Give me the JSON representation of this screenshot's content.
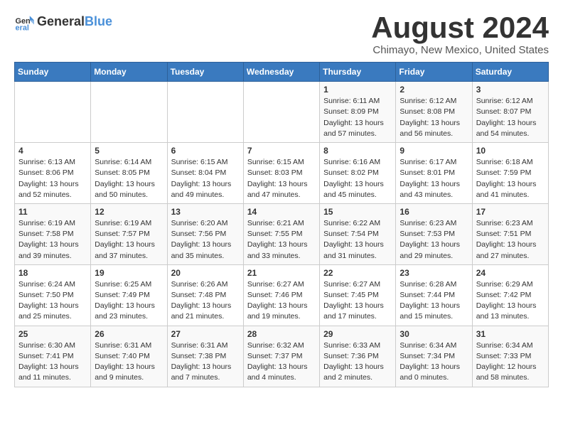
{
  "header": {
    "logo_general": "General",
    "logo_blue": "Blue",
    "month_year": "August 2024",
    "location": "Chimayo, New Mexico, United States"
  },
  "weekdays": [
    "Sunday",
    "Monday",
    "Tuesday",
    "Wednesday",
    "Thursday",
    "Friday",
    "Saturday"
  ],
  "weeks": [
    [
      {
        "day": "",
        "info": ""
      },
      {
        "day": "",
        "info": ""
      },
      {
        "day": "",
        "info": ""
      },
      {
        "day": "",
        "info": ""
      },
      {
        "day": "1",
        "info": "Sunrise: 6:11 AM\nSunset: 8:09 PM\nDaylight: 13 hours\nand 57 minutes."
      },
      {
        "day": "2",
        "info": "Sunrise: 6:12 AM\nSunset: 8:08 PM\nDaylight: 13 hours\nand 56 minutes."
      },
      {
        "day": "3",
        "info": "Sunrise: 6:12 AM\nSunset: 8:07 PM\nDaylight: 13 hours\nand 54 minutes."
      }
    ],
    [
      {
        "day": "4",
        "info": "Sunrise: 6:13 AM\nSunset: 8:06 PM\nDaylight: 13 hours\nand 52 minutes."
      },
      {
        "day": "5",
        "info": "Sunrise: 6:14 AM\nSunset: 8:05 PM\nDaylight: 13 hours\nand 50 minutes."
      },
      {
        "day": "6",
        "info": "Sunrise: 6:15 AM\nSunset: 8:04 PM\nDaylight: 13 hours\nand 49 minutes."
      },
      {
        "day": "7",
        "info": "Sunrise: 6:15 AM\nSunset: 8:03 PM\nDaylight: 13 hours\nand 47 minutes."
      },
      {
        "day": "8",
        "info": "Sunrise: 6:16 AM\nSunset: 8:02 PM\nDaylight: 13 hours\nand 45 minutes."
      },
      {
        "day": "9",
        "info": "Sunrise: 6:17 AM\nSunset: 8:01 PM\nDaylight: 13 hours\nand 43 minutes."
      },
      {
        "day": "10",
        "info": "Sunrise: 6:18 AM\nSunset: 7:59 PM\nDaylight: 13 hours\nand 41 minutes."
      }
    ],
    [
      {
        "day": "11",
        "info": "Sunrise: 6:19 AM\nSunset: 7:58 PM\nDaylight: 13 hours\nand 39 minutes."
      },
      {
        "day": "12",
        "info": "Sunrise: 6:19 AM\nSunset: 7:57 PM\nDaylight: 13 hours\nand 37 minutes."
      },
      {
        "day": "13",
        "info": "Sunrise: 6:20 AM\nSunset: 7:56 PM\nDaylight: 13 hours\nand 35 minutes."
      },
      {
        "day": "14",
        "info": "Sunrise: 6:21 AM\nSunset: 7:55 PM\nDaylight: 13 hours\nand 33 minutes."
      },
      {
        "day": "15",
        "info": "Sunrise: 6:22 AM\nSunset: 7:54 PM\nDaylight: 13 hours\nand 31 minutes."
      },
      {
        "day": "16",
        "info": "Sunrise: 6:23 AM\nSunset: 7:53 PM\nDaylight: 13 hours\nand 29 minutes."
      },
      {
        "day": "17",
        "info": "Sunrise: 6:23 AM\nSunset: 7:51 PM\nDaylight: 13 hours\nand 27 minutes."
      }
    ],
    [
      {
        "day": "18",
        "info": "Sunrise: 6:24 AM\nSunset: 7:50 PM\nDaylight: 13 hours\nand 25 minutes."
      },
      {
        "day": "19",
        "info": "Sunrise: 6:25 AM\nSunset: 7:49 PM\nDaylight: 13 hours\nand 23 minutes."
      },
      {
        "day": "20",
        "info": "Sunrise: 6:26 AM\nSunset: 7:48 PM\nDaylight: 13 hours\nand 21 minutes."
      },
      {
        "day": "21",
        "info": "Sunrise: 6:27 AM\nSunset: 7:46 PM\nDaylight: 13 hours\nand 19 minutes."
      },
      {
        "day": "22",
        "info": "Sunrise: 6:27 AM\nSunset: 7:45 PM\nDaylight: 13 hours\nand 17 minutes."
      },
      {
        "day": "23",
        "info": "Sunrise: 6:28 AM\nSunset: 7:44 PM\nDaylight: 13 hours\nand 15 minutes."
      },
      {
        "day": "24",
        "info": "Sunrise: 6:29 AM\nSunset: 7:42 PM\nDaylight: 13 hours\nand 13 minutes."
      }
    ],
    [
      {
        "day": "25",
        "info": "Sunrise: 6:30 AM\nSunset: 7:41 PM\nDaylight: 13 hours\nand 11 minutes."
      },
      {
        "day": "26",
        "info": "Sunrise: 6:31 AM\nSunset: 7:40 PM\nDaylight: 13 hours\nand 9 minutes."
      },
      {
        "day": "27",
        "info": "Sunrise: 6:31 AM\nSunset: 7:38 PM\nDaylight: 13 hours\nand 7 minutes."
      },
      {
        "day": "28",
        "info": "Sunrise: 6:32 AM\nSunset: 7:37 PM\nDaylight: 13 hours\nand 4 minutes."
      },
      {
        "day": "29",
        "info": "Sunrise: 6:33 AM\nSunset: 7:36 PM\nDaylight: 13 hours\nand 2 minutes."
      },
      {
        "day": "30",
        "info": "Sunrise: 6:34 AM\nSunset: 7:34 PM\nDaylight: 13 hours\nand 0 minutes."
      },
      {
        "day": "31",
        "info": "Sunrise: 6:34 AM\nSunset: 7:33 PM\nDaylight: 12 hours\nand 58 minutes."
      }
    ]
  ]
}
